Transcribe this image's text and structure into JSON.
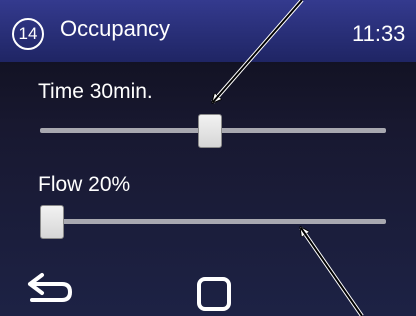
{
  "header": {
    "screen_number": "14",
    "title": "Occupancy",
    "time": "11:33"
  },
  "sliders": [
    {
      "label": "Time 30min.",
      "value_fraction": 0.49
    },
    {
      "label": "Flow 20%",
      "value_fraction": 0.0
    }
  ],
  "footer": {
    "back_icon": "back-arrow-icon",
    "home_icon": "square-icon"
  },
  "colors": {
    "header": "#2b307a",
    "background": "#1a1a33",
    "track": "#a8a8b0",
    "thumb": "#e6e6e6",
    "annotation_arrow": "#000000"
  }
}
